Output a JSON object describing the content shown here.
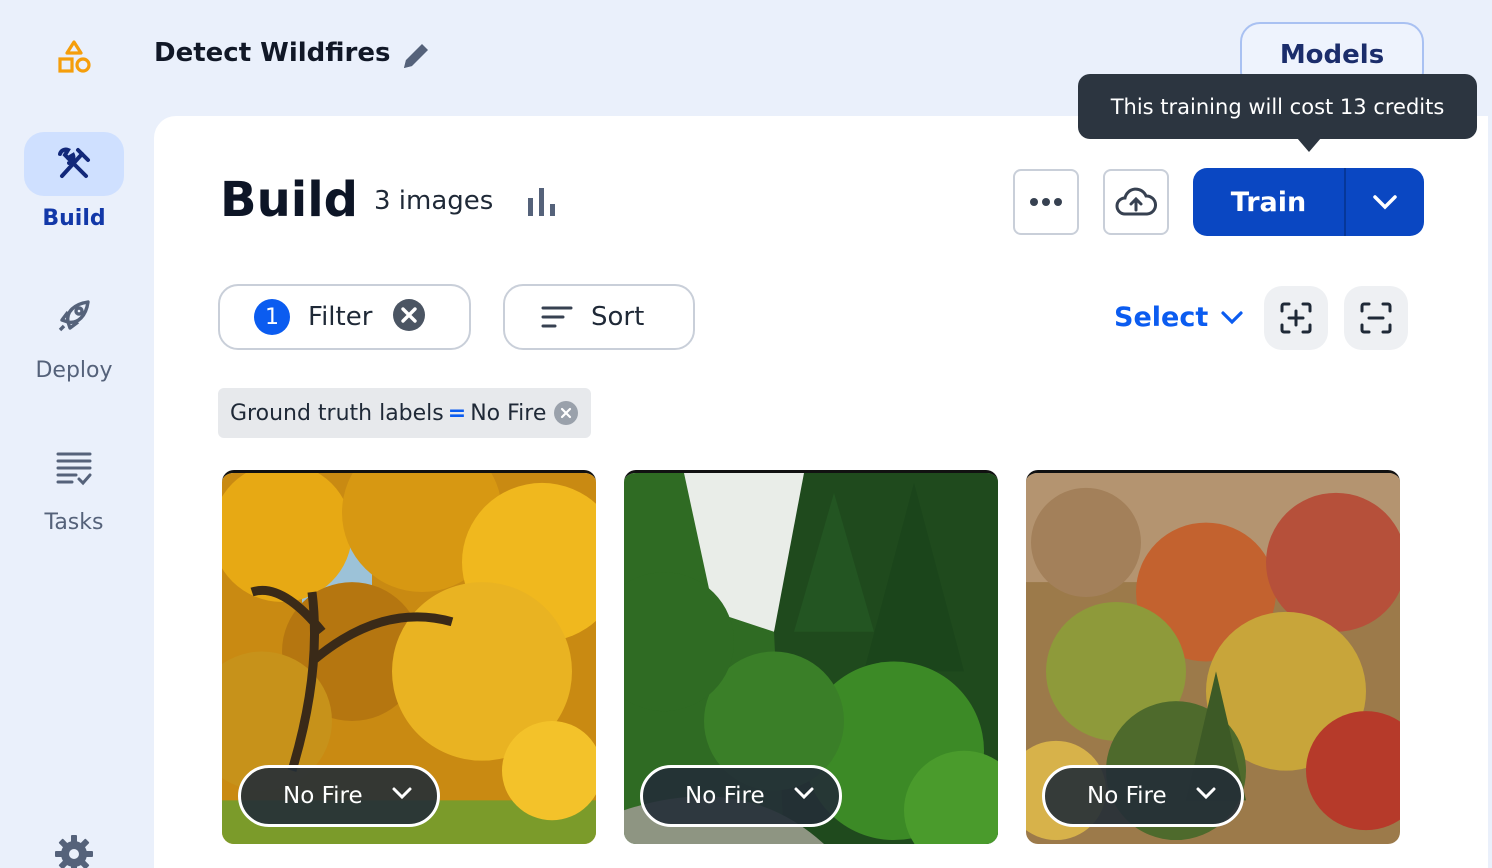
{
  "app": {
    "project_title": "Detect Wildfires",
    "models_label": "Models"
  },
  "sidebar": {
    "items": [
      {
        "label": "Build",
        "icon": "tools-icon",
        "active": true
      },
      {
        "label": "Deploy",
        "icon": "rocket-icon",
        "active": false
      },
      {
        "label": "Tasks",
        "icon": "tasks-list-icon",
        "active": false
      }
    ]
  },
  "main": {
    "title": "Build",
    "image_count": "3 images",
    "train_label": "Train",
    "tooltip": "This training will cost 13 credits",
    "filter": {
      "count": "1",
      "label": "Filter"
    },
    "sort_label": "Sort",
    "select_label": "Select",
    "active_filter": {
      "field": "Ground truth labels",
      "operator": "=",
      "value": "No Fire"
    },
    "images": [
      {
        "label": "No Fire",
        "scene": "yellow autumn tree"
      },
      {
        "label": "No Fire",
        "scene": "green conifer forest"
      },
      {
        "label": "No Fire",
        "scene": "colorful autumn hillside"
      }
    ]
  },
  "colors": {
    "accent": "#0a47c2",
    "link": "#0b5cf0",
    "sidebar_bg": "#eaf0fb",
    "logo": "#f59e0b"
  }
}
